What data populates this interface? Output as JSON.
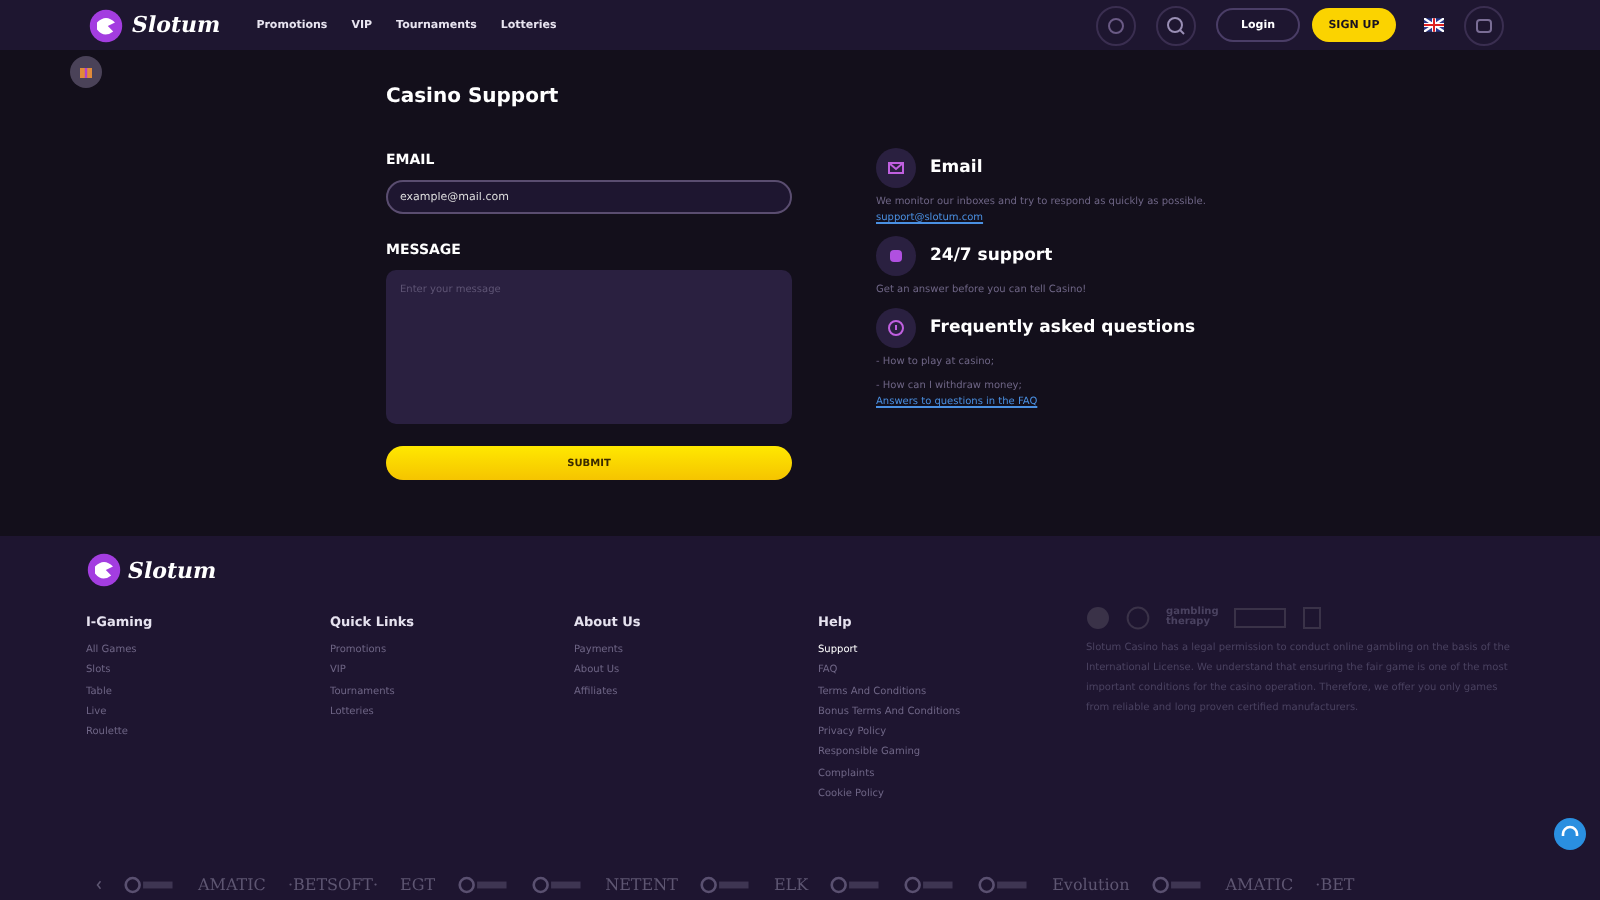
{
  "header": {
    "brand": "Slotum",
    "nav": [
      "Promotions",
      "VIP",
      "Tournaments",
      "Lotteries"
    ],
    "login": "Login",
    "signup": "SIGN UP"
  },
  "form": {
    "title": "Casino Support",
    "email_label": "EMAIL",
    "email_value": "example@mail.com",
    "message_label": "MESSAGE",
    "message_placeholder": "Enter your message",
    "submit": "SUBMIT"
  },
  "contacts": [
    {
      "kind": "email",
      "title": "Email",
      "lines": [
        "We monitor our inboxes and try to respond as quickly as possible."
      ],
      "link": "support@slotum.com"
    },
    {
      "kind": "chat",
      "title": "24/7 support",
      "lines": [
        "Get an answer before you can tell Casino!"
      ]
    },
    {
      "kind": "faq",
      "title": "Frequently asked questions",
      "lines": [
        "- How to play at casino;",
        "- How can I withdraw money;"
      ],
      "link": "Answers to questions in the FAQ"
    }
  ],
  "footer": {
    "brand": "Slotum",
    "columns": [
      {
        "title": "I-Gaming",
        "links": [
          {
            "label": "All Games",
            "selected": false
          },
          {
            "label": "Slots",
            "selected": false
          },
          {
            "label": "Table",
            "selected": false
          },
          {
            "label": "Live",
            "selected": false
          },
          {
            "label": "Roulette",
            "selected": false
          }
        ]
      },
      {
        "title": "Quick Links",
        "links": [
          {
            "label": "Promotions",
            "selected": false
          },
          {
            "label": "VIP",
            "selected": false
          },
          {
            "label": "Tournaments",
            "selected": false
          },
          {
            "label": "Lotteries",
            "selected": false
          }
        ]
      },
      {
        "title": "About Us",
        "links": [
          {
            "label": "Payments",
            "selected": false
          },
          {
            "label": "About Us",
            "selected": false
          },
          {
            "label": "Affiliates",
            "selected": false
          }
        ]
      },
      {
        "title": "Help",
        "links": [
          {
            "label": "Support",
            "selected": true
          },
          {
            "label": "FAQ",
            "selected": false
          },
          {
            "label": "Terms And Conditions",
            "selected": false
          },
          {
            "label": "Bonus Terms And Conditions",
            "selected": false
          },
          {
            "label": "Privacy Policy",
            "selected": false
          },
          {
            "label": "Responsible Gaming",
            "selected": false
          },
          {
            "label": "Complaints",
            "selected": false
          },
          {
            "label": "Cookie Policy",
            "selected": false
          }
        ]
      }
    ],
    "badges": [
      "gambling therapy"
    ],
    "about": "Slotum Casino has a legal permission to conduct online gambling on the basis of the International License. We understand that ensuring the fair game is one of the most important conditions for the casino operation. Therefore, we offer you only games from reliable and long proven certified manufacturers."
  },
  "providers": [
    {
      "kind": "icon"
    },
    {
      "kind": "text",
      "name": "AMATIC"
    },
    {
      "kind": "text",
      "name": "·BETSOFT·"
    },
    {
      "kind": "text",
      "name": "EGT"
    },
    {
      "kind": "icon"
    },
    {
      "kind": "icon"
    },
    {
      "kind": "text",
      "name": "NETENT"
    },
    {
      "kind": "icon"
    },
    {
      "kind": "text",
      "name": "ELK"
    },
    {
      "kind": "icon"
    },
    {
      "kind": "icon"
    },
    {
      "kind": "icon"
    },
    {
      "kind": "text",
      "name": "Evolution"
    },
    {
      "kind": "icon"
    },
    {
      "kind": "text",
      "name": "AMATIC"
    },
    {
      "kind": "text",
      "name": "·BET"
    }
  ]
}
